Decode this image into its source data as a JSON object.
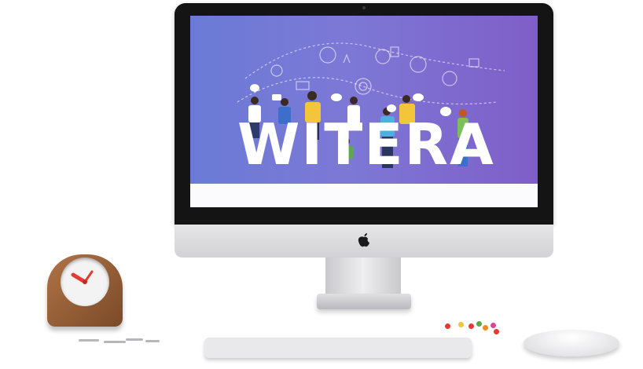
{
  "screen": {
    "brand_text": "WITERA"
  },
  "colors": {
    "hero_gradient_start": "#6a7bd6",
    "hero_gradient_end": "#7f5ec8",
    "clock_wood": "#9b6238",
    "clock_hand": "#e23b33",
    "apple_logo": "#1a1a1a"
  },
  "icons": [
    "apple-logo-icon"
  ]
}
